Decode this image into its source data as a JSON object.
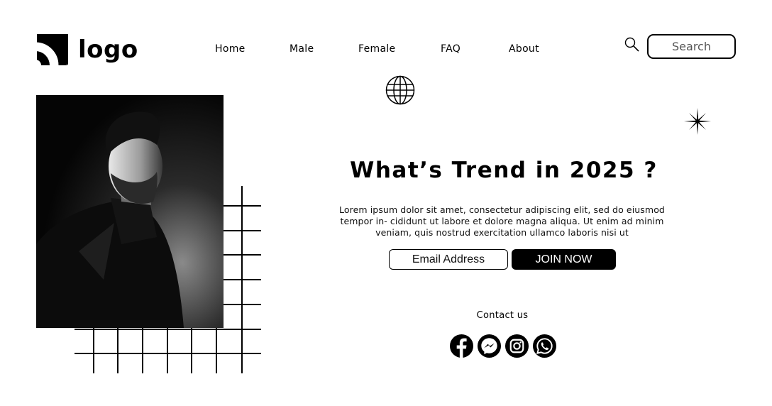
{
  "header": {
    "logo_text": "logo",
    "nav": [
      {
        "label": "Home"
      },
      {
        "label": "Male"
      },
      {
        "label": "Female"
      },
      {
        "label": "FAQ"
      },
      {
        "label": "About"
      }
    ],
    "search": {
      "placeholder": "Search",
      "icon": "search-icon"
    }
  },
  "hero": {
    "headline": "What’s Trend in 2025 ?",
    "body": "Lorem ipsum dolor sit amet, consectetur adipiscing elit, sed do eiusmod tempor in- cididunt ut labore et dolore magna aliqua. Ut enim ad minim veniam, quis nostrud exercitation ullamco laboris nisi ut",
    "email_placeholder": "Email Address",
    "join_label": "JOIN NOW"
  },
  "contact": {
    "label": "Contact us",
    "socials": [
      "facebook-icon",
      "messenger-icon",
      "instagram-icon",
      "whatsapp-icon"
    ]
  },
  "decorations": {
    "globe": "globe-icon",
    "sparkle": "sparkle-icon"
  },
  "colors": {
    "primary": "#000000",
    "background": "#ffffff"
  }
}
